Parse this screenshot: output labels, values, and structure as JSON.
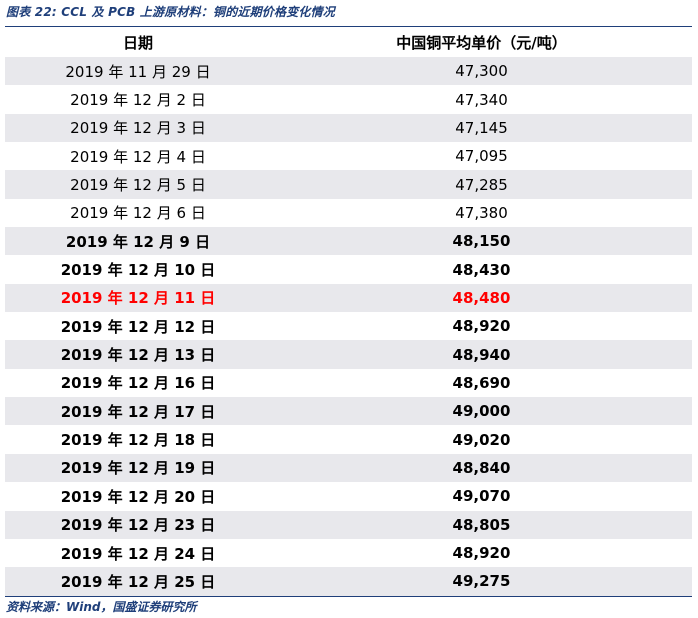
{
  "caption": "图表 22:  CCL 及 PCB 上游原材料：铜的近期价格变化情况",
  "table": {
    "headers": {
      "date": "日期",
      "price": "中国铜平均单价（元/吨）"
    },
    "rows": [
      {
        "date": "2019 年 11 月 29 日",
        "price": "47,300",
        "style": "normal"
      },
      {
        "date": "2019 年 12 月 2 日",
        "price": "47,340",
        "style": "normal"
      },
      {
        "date": "2019 年 12 月 3 日",
        "price": "47,145",
        "style": "normal"
      },
      {
        "date": "2019 年 12 月 4 日",
        "price": "47,095",
        "style": "normal"
      },
      {
        "date": "2019 年 12 月 5 日",
        "price": "47,285",
        "style": "normal"
      },
      {
        "date": "2019 年 12 月 6 日",
        "price": "47,380",
        "style": "normal"
      },
      {
        "date": "2019 年 12 月 9 日",
        "price": "48,150",
        "style": "bold"
      },
      {
        "date": "2019 年 12 月 10 日",
        "price": "48,430",
        "style": "bold"
      },
      {
        "date": "2019 年 12 月 11 日",
        "price": "48,480",
        "style": "highlight"
      },
      {
        "date": "2019 年 12 月 12 日",
        "price": "48,920",
        "style": "bold"
      },
      {
        "date": "2019 年 12 月 13 日",
        "price": "48,940",
        "style": "bold"
      },
      {
        "date": "2019 年 12 月 16 日",
        "price": "48,690",
        "style": "bold"
      },
      {
        "date": "2019 年 12 月 17 日",
        "price": "49,000",
        "style": "bold"
      },
      {
        "date": "2019 年 12 月 18 日",
        "price": "49,020",
        "style": "bold"
      },
      {
        "date": "2019 年 12 月 19 日",
        "price": "48,840",
        "style": "bold"
      },
      {
        "date": "2019 年 12 月 20 日",
        "price": "49,070",
        "style": "bold"
      },
      {
        "date": "2019 年 12 月 23 日",
        "price": "48,805",
        "style": "bold"
      },
      {
        "date": "2019 年 12 月 24 日",
        "price": "48,920",
        "style": "bold"
      },
      {
        "date": "2019 年 12 月 25 日",
        "price": "49,275",
        "style": "bold"
      }
    ]
  },
  "source": "资料来源：Wind，国盛证券研究所",
  "colors": {
    "caption": "#1f3f7a",
    "shade": "#e8e8ec",
    "highlight": "#ff0000"
  }
}
